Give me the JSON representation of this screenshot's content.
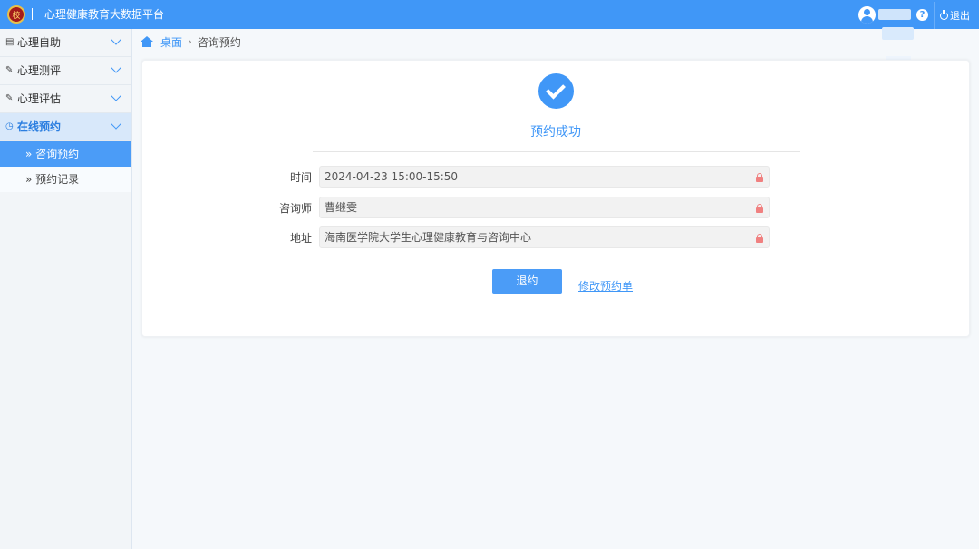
{
  "header": {
    "logo_text": "校",
    "title": "心理健康教育大数据平台",
    "help_glyph": "?",
    "logout_label": "退出"
  },
  "sidebar": {
    "items": [
      {
        "label": "心理自助",
        "icon": "book-icon",
        "glyph": "▤"
      },
      {
        "label": "心理测评",
        "icon": "edit-icon",
        "glyph": "✎"
      },
      {
        "label": "心理评估",
        "icon": "edit-icon",
        "glyph": "✎"
      },
      {
        "label": "在线预约",
        "icon": "clock-icon",
        "glyph": "◷"
      }
    ],
    "sub_items": [
      {
        "label": "» 咨询预约"
      },
      {
        "label": "» 预约记录"
      }
    ]
  },
  "breadcrumb": {
    "home": "桌面",
    "separator": "›",
    "current": "咨询预约"
  },
  "result": {
    "title": "预约成功",
    "fields": [
      {
        "label": "时间",
        "value": "2024-04-23 15:00-15:50"
      },
      {
        "label": "咨询师",
        "value": "曹继雯"
      },
      {
        "label": "地址",
        "value": "海南医学院大学生心理健康教育与咨询中心"
      }
    ],
    "cancel_label": "退约",
    "modify_label": "修改预约单"
  },
  "colors": {
    "primary": "#4097f7",
    "lock": "#f08080"
  }
}
